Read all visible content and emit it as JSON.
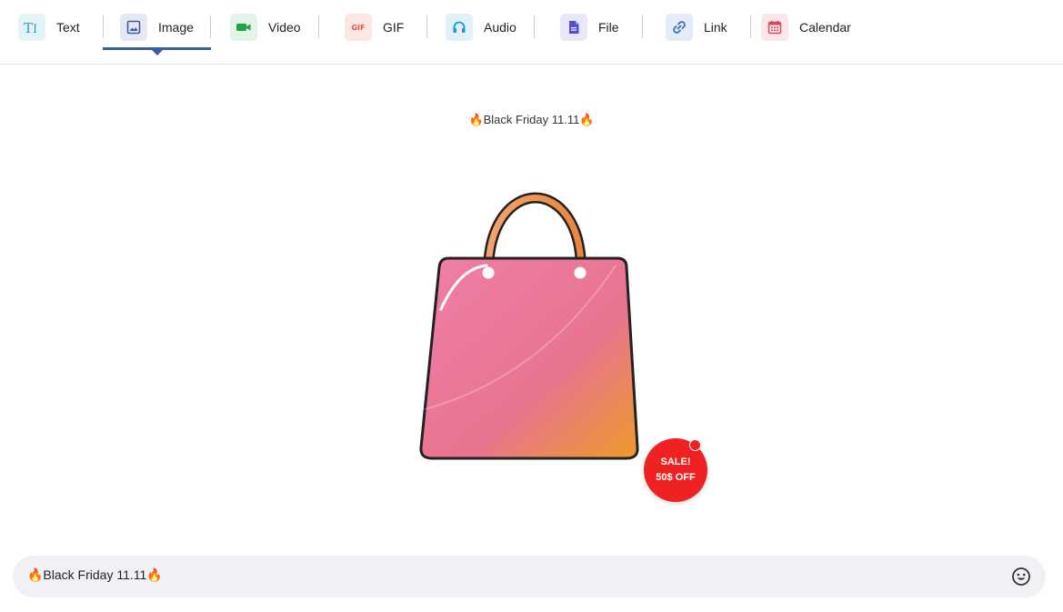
{
  "tabs": [
    {
      "label": "Text",
      "icon": "text-format-icon"
    },
    {
      "label": "Image",
      "icon": "image-icon"
    },
    {
      "label": "Video",
      "icon": "video-camera-icon"
    },
    {
      "label": "GIF",
      "icon": "gif-icon"
    },
    {
      "label": "Audio",
      "icon": "headphones-icon"
    },
    {
      "label": "File",
      "icon": "file-icon"
    },
    {
      "label": "Link",
      "icon": "link-icon"
    },
    {
      "label": "Calendar",
      "icon": "calendar-icon"
    }
  ],
  "active_tab": "Image",
  "gif_badge": "GIF",
  "preview": {
    "caption": "🔥Black Friday 11.11🔥",
    "image": "shopping-bag-illustration",
    "sale_badge": {
      "line1": "SALE!",
      "line2": "50$ OFF"
    }
  },
  "message_input": {
    "value": "🔥Black Friday 11.11🔥",
    "emoji_icon": "smiley-icon"
  },
  "colors": {
    "accent": "#3f5d9e",
    "sale_red": "#ee2222",
    "input_bg": "#f0f1f4"
  }
}
